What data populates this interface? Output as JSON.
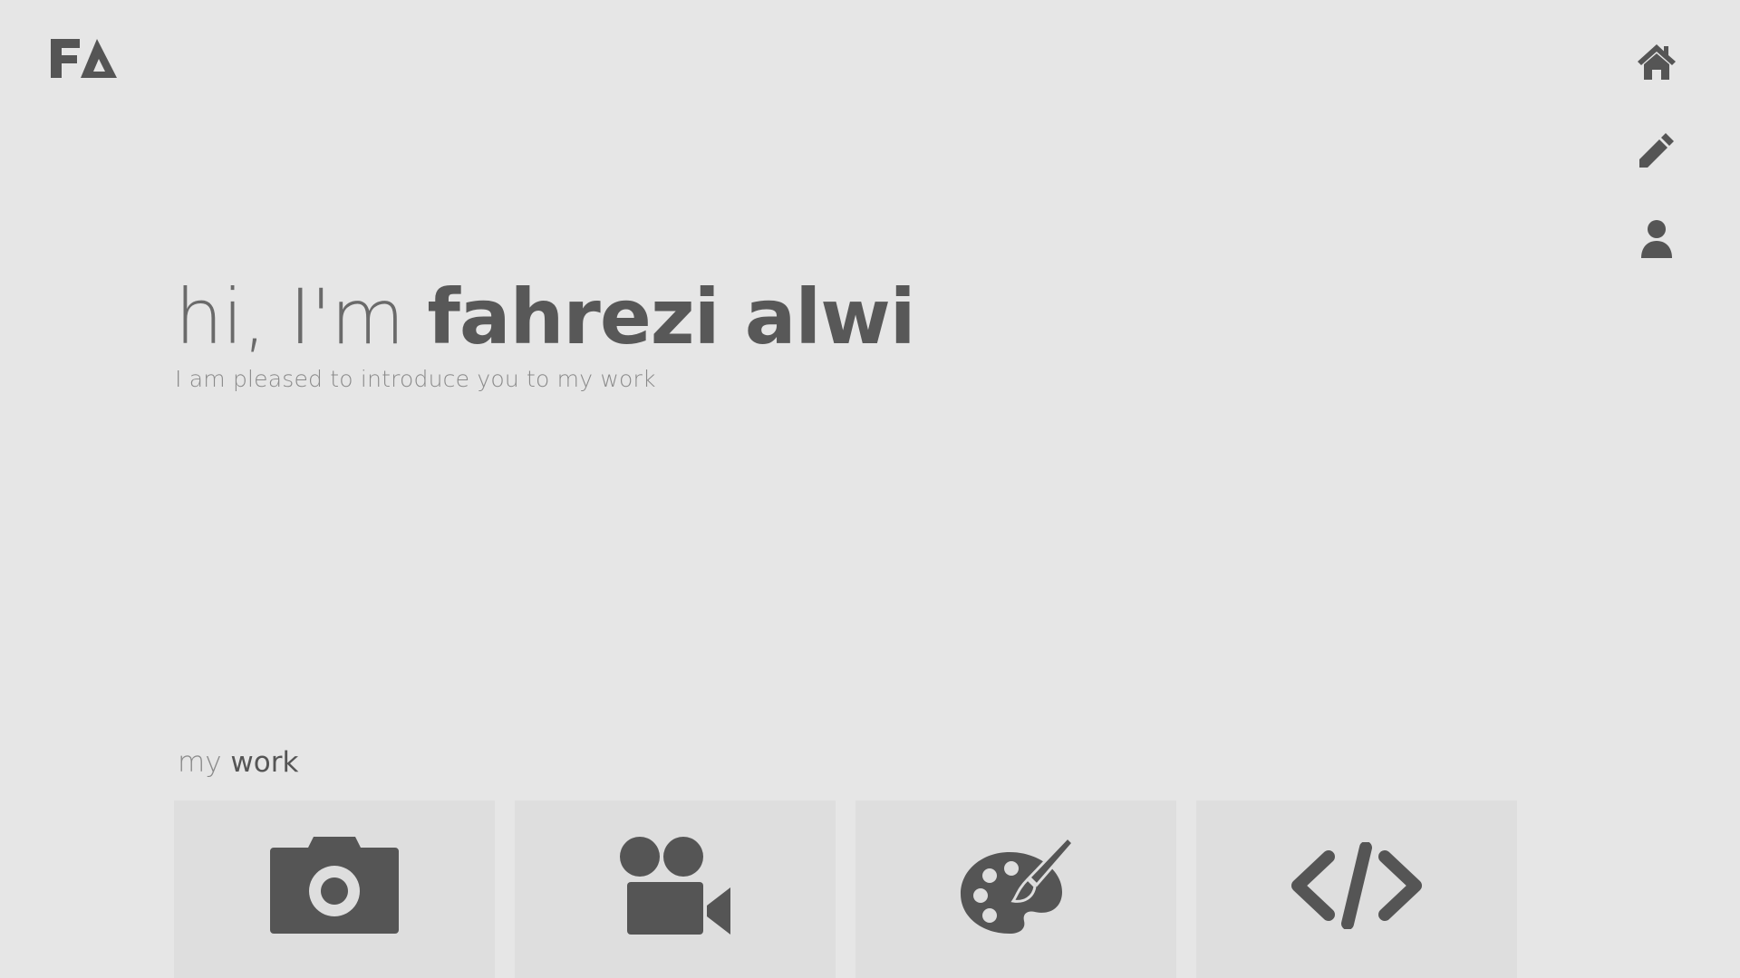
{
  "logo": {
    "text": "FA",
    "icon": "fa-monogram-logo"
  },
  "nav": {
    "items": [
      {
        "icon": "home-icon"
      },
      {
        "icon": "pencil-icon"
      },
      {
        "icon": "user-icon"
      }
    ]
  },
  "hero": {
    "greeting": "hi, I'm ",
    "name": "fahrezi alwi",
    "subtitle": "I am pleased to introduce you to my work"
  },
  "work": {
    "heading_muted": "my ",
    "heading_bold": "work",
    "cards": [
      {
        "icon": "camera-icon"
      },
      {
        "icon": "video-camera-icon"
      },
      {
        "icon": "palette-icon"
      },
      {
        "icon": "code-icon"
      }
    ]
  },
  "colors": {
    "background": "#e6e6e6",
    "card": "#dedede",
    "icon": "#555555",
    "text_dark": "#585858",
    "text_muted": "#8a8a8a"
  }
}
